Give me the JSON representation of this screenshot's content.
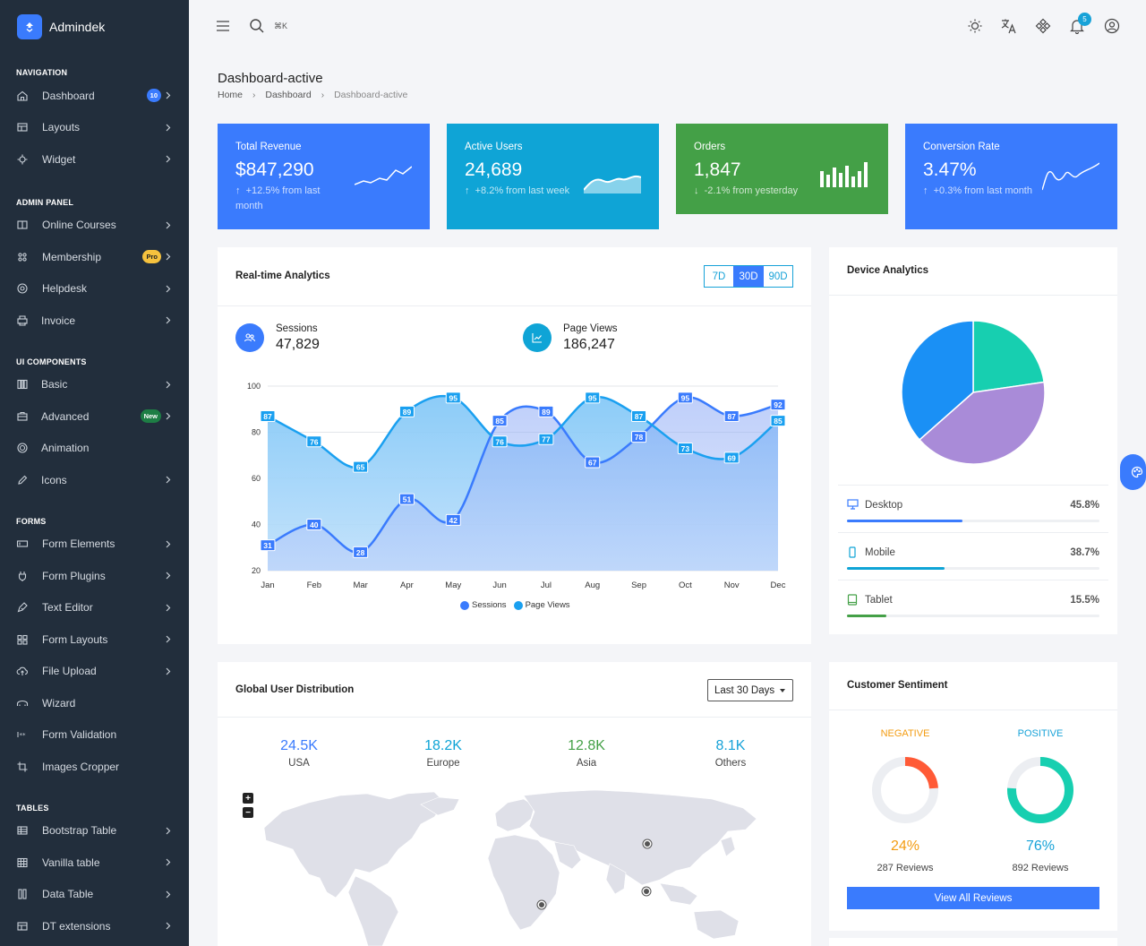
{
  "brand": {
    "name": "Admindek"
  },
  "sidebar": {
    "sections": {
      "navigation": "NAVIGATION",
      "admin_panel": "ADMIN PANEL",
      "ui_components": "UI COMPONENTS",
      "forms": "FORMS",
      "tables": "TABLES"
    },
    "items": {
      "dashboard": {
        "label": "Dashboard",
        "badge": "10",
        "icon": "home-icon"
      },
      "layouts": {
        "label": "Layouts",
        "icon": "layout-icon"
      },
      "widget": {
        "label": "Widget",
        "icon": "widget-icon"
      },
      "online_courses": {
        "label": "Online Courses",
        "icon": "book-icon"
      },
      "membership": {
        "label": "Membership",
        "badge": "Pro",
        "icon": "users-group-icon"
      },
      "helpdesk": {
        "label": "Helpdesk",
        "icon": "lifebuoy-icon"
      },
      "invoice": {
        "label": "Invoice",
        "icon": "printer-icon"
      },
      "basic": {
        "label": "Basic",
        "icon": "columns-icon"
      },
      "advanced": {
        "label": "Advanced",
        "badge": "New",
        "icon": "briefcase-icon"
      },
      "animation": {
        "label": "Animation",
        "icon": "animation-icon"
      },
      "icons": {
        "label": "Icons",
        "icon": "pencil-icon"
      },
      "form_elements": {
        "label": "Form Elements",
        "icon": "form-icon"
      },
      "form_plugins": {
        "label": "Form Plugins",
        "icon": "plug-icon"
      },
      "text_editor": {
        "label": "Text Editor",
        "icon": "pen-icon"
      },
      "form_layouts": {
        "label": "Form Layouts",
        "icon": "grid-icon"
      },
      "file_upload": {
        "label": "File Upload",
        "icon": "cloud-upload-icon"
      },
      "wizard": {
        "label": "Wizard",
        "icon": "wizard-icon"
      },
      "form_validation": {
        "label": "Form Validation",
        "icon": "validation-icon"
      },
      "images_cropper": {
        "label": "Images Cropper",
        "icon": "crop-icon"
      },
      "bootstrap_table": {
        "label": "Bootstrap Table",
        "icon": "table-icon"
      },
      "vanilla_table": {
        "label": "Vanilla table",
        "icon": "table-grid-icon"
      },
      "data_table": {
        "label": "Data Table",
        "icon": "data-table-icon"
      },
      "dt_extensions": {
        "label": "DT extensions",
        "icon": "extension-icon"
      }
    }
  },
  "topbar": {
    "shortcut": "⌘K",
    "notifications_count": "5"
  },
  "page": {
    "title": "Dashboard-active",
    "breadcrumb": [
      "Home",
      "Dashboard",
      "Dashboard-active"
    ]
  },
  "kpis": {
    "revenue": {
      "title": "Total Revenue",
      "value": "$847,290",
      "change": "+12.5% from last month",
      "color": "#3a7bfd"
    },
    "users": {
      "title": "Active Users",
      "value": "24,689",
      "change": "+8.2% from last week",
      "color": "#0fa4d6"
    },
    "orders": {
      "title": "Orders",
      "value": "1,847",
      "change": "-2.1% from yesterday",
      "color": "#44a047"
    },
    "conversion": {
      "title": "Conversion Rate",
      "value": "3.47%",
      "change": "+0.3% from last month",
      "color": "#3a7bfd"
    }
  },
  "analytics": {
    "title": "Real-time Analytics",
    "ranges": [
      "7D",
      "30D",
      "90D"
    ],
    "selected_range": "30D",
    "sessions": {
      "label": "Sessions",
      "value": "47,829"
    },
    "page_views": {
      "label": "Page Views",
      "value": "186,247"
    }
  },
  "chart_data": {
    "type": "area",
    "categories": [
      "Jan",
      "Feb",
      "Mar",
      "Apr",
      "May",
      "Jun",
      "Jul",
      "Aug",
      "Sep",
      "Oct",
      "Nov",
      "Dec"
    ],
    "series": [
      {
        "name": "Sessions",
        "values": [
          31,
          40,
          28,
          51,
          42,
          85,
          89,
          67,
          78,
          95,
          87,
          92
        ],
        "color": "#3a7bfd"
      },
      {
        "name": "Page Views",
        "values": [
          87,
          76,
          65,
          89,
          95,
          76,
          77,
          95,
          87,
          73,
          69,
          85
        ],
        "color": "#1aa0f0"
      }
    ],
    "ylim": [
      20,
      100
    ],
    "yticks": [
      20,
      40,
      60,
      80,
      100
    ],
    "grid": true,
    "legend": "bottom"
  },
  "device": {
    "title": "Device Analytics",
    "rows": [
      {
        "label": "Desktop",
        "pct": "45.8%",
        "value": 45.8,
        "color": "#3a7bfd",
        "icon": "desktop-icon"
      },
      {
        "label": "Mobile",
        "pct": "38.7%",
        "value": 38.7,
        "color": "#0fa4d6",
        "icon": "mobile-icon"
      },
      {
        "label": "Tablet",
        "pct": "15.5%",
        "value": 15.5,
        "color": "#44a047",
        "icon": "tablet-icon"
      }
    ],
    "pie_colors": [
      "#17cfb0",
      "#a98bd8",
      "#1a90f5"
    ]
  },
  "global": {
    "title": "Global User Distribution",
    "range": "Last 30 Days",
    "regions": [
      {
        "value": "24.5K",
        "label": "USA",
        "color": "#3a7bfd"
      },
      {
        "value": "18.2K",
        "label": "Europe",
        "color": "#0fa4d6"
      },
      {
        "value": "12.8K",
        "label": "Asia",
        "color": "#44a047"
      },
      {
        "value": "8.1K",
        "label": "Others",
        "color": "#17a2d8"
      }
    ]
  },
  "sentiment": {
    "title": "Customer Sentiment",
    "negative": {
      "label": "NEGATIVE",
      "pct": "24%",
      "value": 24,
      "reviews": "287 Reviews",
      "color": "#ff5a36",
      "text_color": "#f39c12"
    },
    "positive": {
      "label": "POSITIVE",
      "pct": "76%",
      "value": 76,
      "reviews": "892 Reviews",
      "color": "#17cfb0",
      "text_color": "#17a2d8"
    },
    "button": "View All Reviews"
  }
}
